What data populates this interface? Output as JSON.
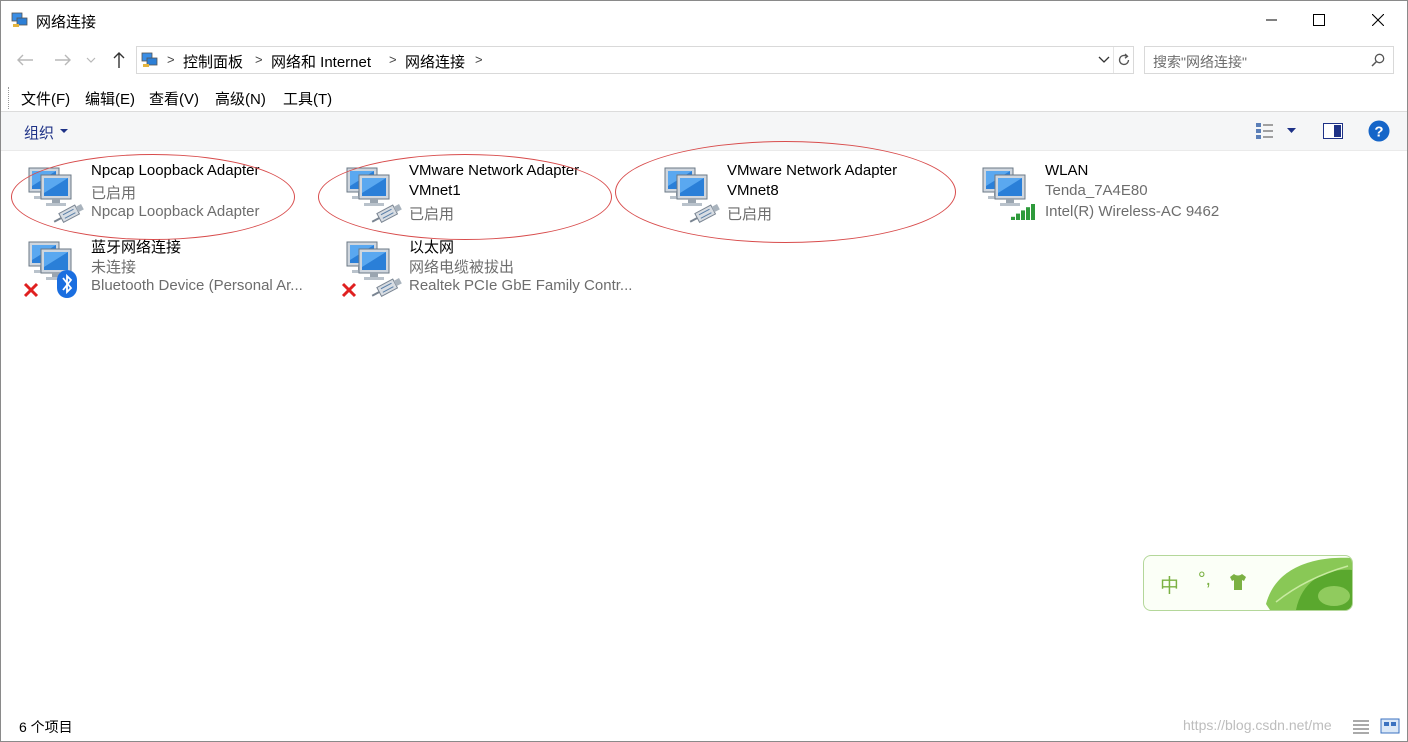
{
  "window": {
    "title": "网络连接"
  },
  "address": {
    "crumbs": [
      "控制面板",
      "网络和 Internet",
      "网络连接"
    ]
  },
  "search": {
    "placeholder": "搜索\"网络连接\""
  },
  "menu": [
    "文件(F)",
    "编辑(E)",
    "查看(V)",
    "高级(N)",
    "工具(T)"
  ],
  "commandbar": {
    "organize": "组织"
  },
  "items": [
    {
      "line1": "Npcap Loopback Adapter",
      "line2": "已启用",
      "line3": "Npcap Loopback Adapter",
      "icon": "network-adapter-icon",
      "circled": true
    },
    {
      "line1": "VMware Network Adapter",
      "line2": "VMnet1",
      "line3": "已启用",
      "icon": "network-adapter-icon",
      "circled": true
    },
    {
      "line1": "VMware Network Adapter",
      "line2": "VMnet8",
      "line3": "已启用",
      "icon": "network-adapter-icon",
      "circled": true
    },
    {
      "line1": "WLAN",
      "line2": "Tenda_7A4E80",
      "line3": "Intel(R) Wireless-AC 9462",
      "icon": "wifi-adapter-icon",
      "circled": false
    },
    {
      "line1": "蓝牙网络连接",
      "line2": "未连接",
      "line3": "Bluetooth Device (Personal Ar...",
      "icon": "bluetooth-adapter-icon",
      "circled": false
    },
    {
      "line1": "以太网",
      "line2": "网络电缆被拔出",
      "line3": "Realtek PCIe GbE Family Contr...",
      "icon": "ethernet-adapter-icon",
      "circled": false
    }
  ],
  "status": {
    "count": "6 个项目"
  },
  "ime": {
    "mode": "中",
    "punct": "°,"
  },
  "watermark": "https://blog.csdn.net/me",
  "colors": {
    "accent": "#1e3287",
    "annotation": "#d84c4c",
    "ime_green": "#7bb143"
  }
}
